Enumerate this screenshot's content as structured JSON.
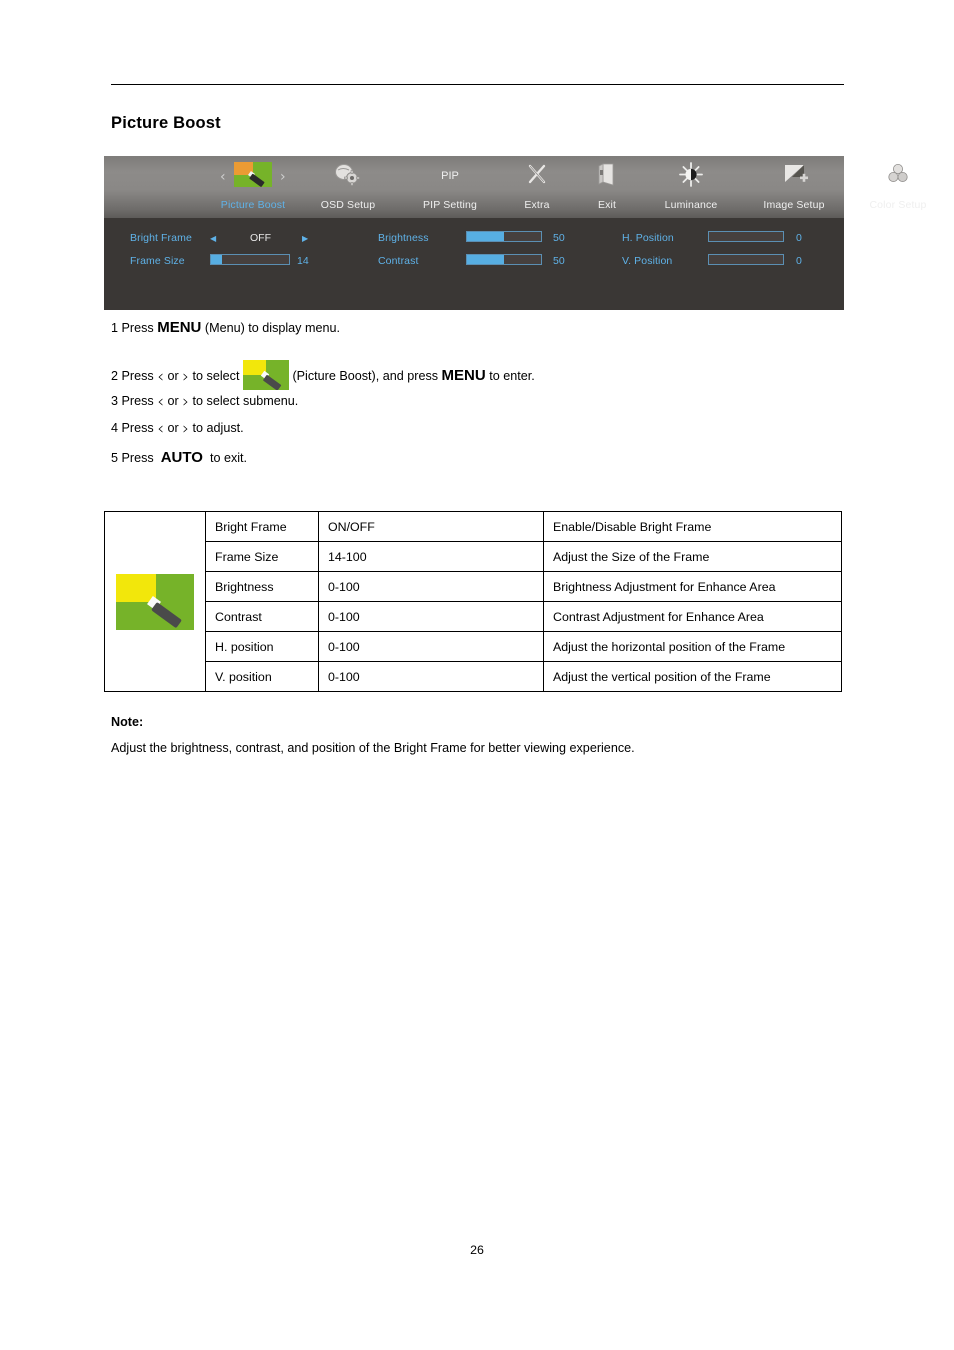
{
  "document": {
    "page_title": "Picture Boost",
    "page_number": "26"
  },
  "osd": {
    "menu_items": [
      {
        "label": "Picture Boost",
        "icon": "picture-boost-tile-icon",
        "active": true
      },
      {
        "label": "OSD Setup",
        "icon": "osd-setup-icon",
        "active": false
      },
      {
        "label": "PIP Setting",
        "icon": "pip-text-icon",
        "icon_text": "PIP",
        "active": false
      },
      {
        "label": "Extra",
        "icon": "extra-scissors-icon",
        "active": false
      },
      {
        "label": "Exit",
        "icon": "exit-door-icon",
        "active": false
      },
      {
        "label": "Luminance",
        "icon": "luminance-sun-icon",
        "active": false
      },
      {
        "label": "Image Setup",
        "icon": "image-setup-icon",
        "active": false
      },
      {
        "label": "Color Setup",
        "icon": "color-setup-icon",
        "active": false
      }
    ],
    "controls": {
      "bright_frame": {
        "label": "Bright Frame",
        "value": "OFF",
        "left_arrow": "◀",
        "right_arrow": "▶"
      },
      "frame_size": {
        "label": "Frame Size",
        "value": "14",
        "fill_percent": 14
      },
      "brightness": {
        "label": "Brightness",
        "value": "50",
        "fill_percent": 50
      },
      "contrast": {
        "label": "Contrast",
        "value": "50",
        "fill_percent": 50
      },
      "h_position": {
        "label": "H. Position",
        "value": "0",
        "fill_percent": 0
      },
      "v_position": {
        "label": "V. Position",
        "value": "0",
        "fill_percent": 0
      }
    },
    "colors": {
      "accent_blue": "#5fb2e8",
      "slider_fill": "#57aee2",
      "panel_bg": "#3a3735",
      "topbar_gray": "#8a8886",
      "tile_green": "#76b329",
      "tile_orange": "#eb9b33",
      "tile_yellow": "#f2e70b"
    }
  },
  "steps": {
    "step1": {
      "num": "1",
      "pre": "Press ",
      "key": "MENU",
      "post": " (Menu) to display menu."
    },
    "step2": {
      "num": "2",
      "pre": "Press ",
      "chev_left": "‹",
      "mid_or": " or ",
      "chev_right": "›",
      "to_select": " to select ",
      "icon": "picture-boost-tile-icon",
      "after_icon": " (Picture Boost), and press ",
      "key": "MENU",
      "post": " to enter."
    },
    "step3": {
      "num": "3",
      "pre": "Press ",
      "chev_left": "‹",
      "mid_or": " or ",
      "chev_right": "›",
      "post": " to select submenu."
    },
    "step4": {
      "num": "4",
      "pre": "Press ",
      "chev_left": "‹",
      "mid_or": " or ",
      "chev_right": "›",
      "post": " to adjust."
    },
    "step5": {
      "num": "5",
      "pre": "Press ",
      "key": "AUTO",
      "post": " to exit."
    }
  },
  "spec_table": {
    "icon_alt": "picture-boost-tile-icon",
    "rows": [
      {
        "name": "Bright Frame",
        "range": "ON/OFF",
        "description": "Enable/Disable Bright Frame"
      },
      {
        "name": "Frame Size",
        "range": "14-100",
        "description": "Adjust the Size of the Frame"
      },
      {
        "name": "Brightness",
        "range": "0-100",
        "description": "Brightness Adjustment for Enhance Area"
      },
      {
        "name": "Contrast",
        "range": "0-100",
        "description": "Contrast Adjustment for Enhance Area"
      },
      {
        "name": "H. position",
        "range": "0-100",
        "description": "Adjust the horizontal position of the Frame"
      },
      {
        "name": "V. position",
        "range": "0-100",
        "description": "Adjust the vertical position of the Frame"
      }
    ]
  },
  "note": {
    "title": "Note:",
    "body": "Adjust the brightness, contrast, and position of the Bright Frame for better viewing experience."
  }
}
